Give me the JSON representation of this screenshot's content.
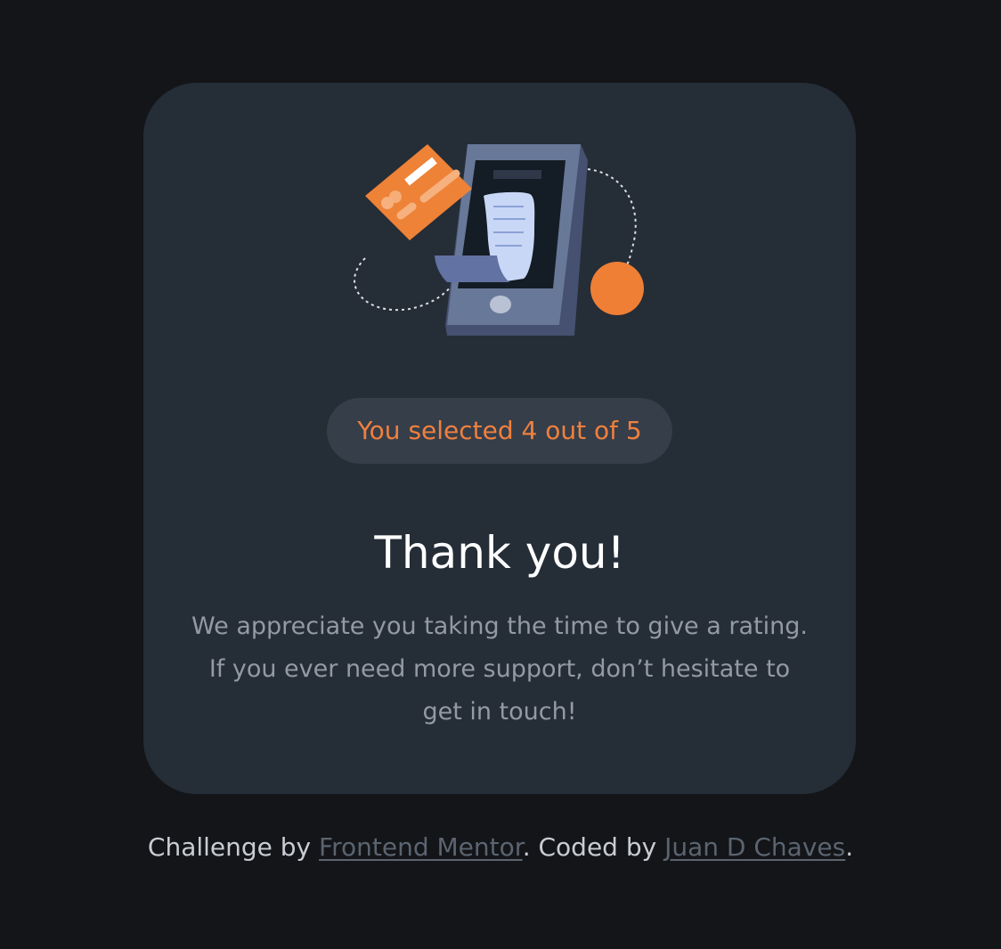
{
  "card": {
    "rating_message": "You selected 4 out of 5",
    "title": "Thank you!",
    "message_lines": [
      "We appreciate you taking the time to give a rating.",
      "If you ever need more support, don’t hesitate to",
      "get in touch!"
    ],
    "selected_rating": 4,
    "max_rating": 5
  },
  "footer": {
    "challenge_prefix": "Challenge by ",
    "challenge_link": "Frontend Mentor",
    "coded_prefix": ". Coded by ",
    "author_link": "Juan D Chaves",
    "suffix": "."
  },
  "colors": {
    "page_background": "#131518",
    "card_background": "#252d37",
    "accent_orange": "#f0803e",
    "pill_background": "#363e4a",
    "message_gray": "#949aa5",
    "link_gray": "#5b6470"
  },
  "icons": {
    "illustration": "payment-receipt-phone-illustration"
  }
}
